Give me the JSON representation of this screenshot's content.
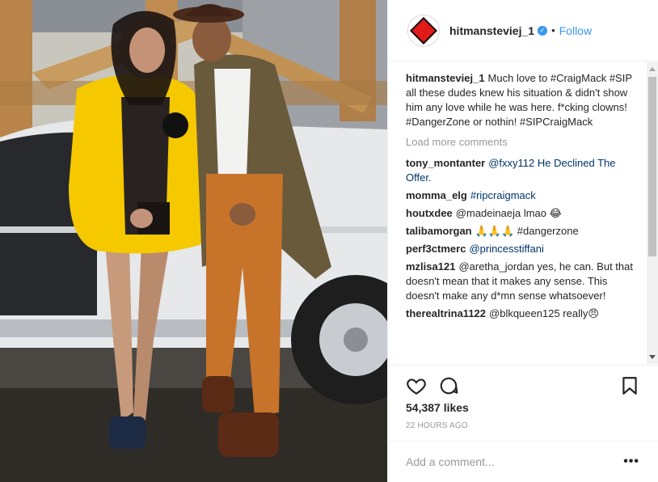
{
  "post": {
    "username": "hitmansteviej_1",
    "follow_label": "Follow",
    "separator": "•",
    "verified_mark": "✓",
    "caption_username": "hitmansteviej_1",
    "caption_text": "Much love to #CraigMack #SIP all these dudes knew his situation & didn't show him any love while he was here. f*cking clowns! #DangerZone or nothin! #SIPCraigMack",
    "load_more": "Load more comments",
    "comments": [
      {
        "user": "tony_montanter",
        "text": "@fxxy112 He Declined The Offer."
      },
      {
        "user": "momma_elg",
        "text": "#ripcraigmack"
      },
      {
        "user": "houtxdee",
        "text": "@madeinaeja lmao 😂"
      },
      {
        "user": "talibamorgan",
        "text": "🙏🙏🙏 #dangerzone"
      },
      {
        "user": "perf3ctmerc",
        "text": "@princesstiffani"
      },
      {
        "user": "mzlisa121",
        "text": "@aretha_jordan yes, he can. But that doesn't mean that it makes any sense. This doesn't make any d*mn sense whatsoever!"
      },
      {
        "user": "therealtrina1122",
        "text": "@blkqueen125 really😠"
      }
    ],
    "likes": "54,387 likes",
    "timestamp": "22 HOURS AGO",
    "add_comment_placeholder": "Add a comment...",
    "more_label": "•••"
  },
  "colors": {
    "link": "#3897f0",
    "brand_red": "#e31a1a",
    "fur_yellow": "#f5c800",
    "pants_orange": "#c8732a"
  },
  "icons": {
    "avatar": "diamond-logo-icon",
    "verified": "verified-badge-icon",
    "like": "heart-icon",
    "comment": "comment-bubble-icon",
    "save": "bookmark-icon",
    "options": "ellipsis-icon"
  }
}
